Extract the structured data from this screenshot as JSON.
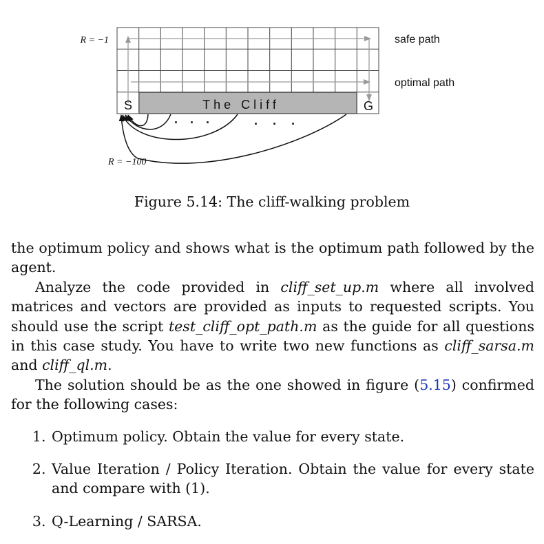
{
  "figure": {
    "reward_top": "R = −1",
    "reward_bottom": "R = −100",
    "safe_label": "safe path",
    "optimal_label": "optimal path",
    "start_label": "S",
    "goal_label": "G",
    "cliff_label": "The Cliff",
    "dots_left": "· · ·",
    "dots_right": "· · ·",
    "caption": "Figure 5.14: The cliff-walking problem"
  },
  "text": {
    "para1": "the optimum policy and shows what is the optimum path followed by the agent.",
    "para2_a": "Analyze the code provided in ",
    "file_setup": "cliff_set_up.m",
    "para2_b": " where all involved matrices and vectors are provided as inputs to requested scripts. You should use the script ",
    "file_test": "test_cliff_opt_path.m",
    "para2_c": " as the guide for all questions in this case study. You have to write two new functions as ",
    "file_sarsa": "cliff_sarsa.m",
    "para2_d": " and ",
    "file_ql": "cliff_ql.m",
    "para2_e": ".",
    "para3_a": "The solution should be as the one showed in figure (",
    "para3_ref": "5.15",
    "para3_b": ") confirmed for the following cases:"
  },
  "list": [
    {
      "text": "Optimum policy. Obtain the value for every state."
    },
    {
      "text": "Value Iteration / Policy Iteration. Obtain the value for every state and compare with (1)."
    },
    {
      "text": "Q-Learning / SARSA."
    }
  ]
}
